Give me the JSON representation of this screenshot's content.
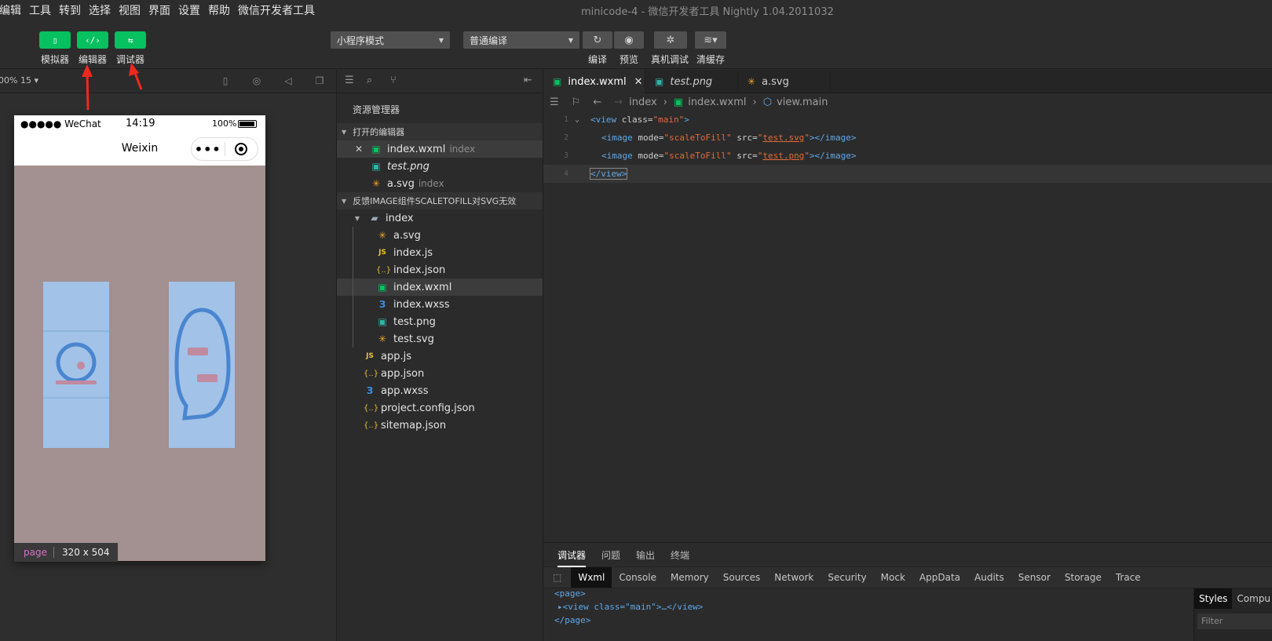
{
  "menubar": {
    "items": [
      "编辑",
      "工具",
      "转到",
      "选择",
      "视图",
      "界面",
      "设置",
      "帮助",
      "微信开发者工具"
    ],
    "window_title": "minicode-4 - 微信开发者工具 Nightly 1.04.2011032"
  },
  "toolbar": {
    "simulator_label": "模拟器",
    "editor_label": "编辑器",
    "debugger_label": "调试器",
    "mode_select": "小程序模式",
    "compile_select": "普通编译",
    "compile_label": "编译",
    "preview_label": "预览",
    "device_debug_label": "真机调试",
    "clear_cache_label": "清缓存",
    "accent_color": "#07c160"
  },
  "simulator": {
    "zoom": "00% 15",
    "carrier": "●●●●● WeChat",
    "time": "14:19",
    "battery": "100%",
    "nav_title": "Weixin",
    "page_tag": "page",
    "page_size": "320 x 504",
    "background_color": "#a39090",
    "image_fill_color": "#a2c2e8"
  },
  "explorer": {
    "header": "资源管理器",
    "open_editors_section": "打开的编辑器",
    "open_editors": [
      {
        "name": "index.wxml",
        "hint": "index",
        "icon": "wxml-icon"
      },
      {
        "name": "test.png",
        "hint": "",
        "icon": "png-icon"
      },
      {
        "name": "a.svg",
        "hint": "index",
        "icon": "svg-icon"
      }
    ],
    "project_section": "反馈IMAGE组件SCALETOFILL对SVG无效",
    "folder": "index",
    "folder_files": [
      "a.svg",
      "index.js",
      "index.json",
      "index.wxml",
      "index.wxss",
      "test.png",
      "test.svg"
    ],
    "root_files": [
      "app.js",
      "app.json",
      "app.wxss",
      "project.config.json",
      "sitemap.json"
    ]
  },
  "editor": {
    "tabs": [
      {
        "label": "index.wxml",
        "close": "✕"
      },
      {
        "label": "test.png",
        "close": ""
      },
      {
        "label": "a.svg",
        "close": ""
      }
    ],
    "breadcrumb": {
      "folder": "index",
      "file": "index.wxml",
      "symbol": "view.main"
    },
    "lines": {
      "l1": {
        "num": "1",
        "open": "<view ",
        "attr": "class=",
        "val": "\"main\"",
        "close": ">"
      },
      "l2": {
        "num": "2",
        "open": "<image ",
        "attr1": "mode=",
        "val1": "\"scaleToFill\"",
        "attr2": " src=",
        "q1": "\"",
        "link": "test.svg",
        "q2": "\"",
        "close": "></image>"
      },
      "l3": {
        "num": "3",
        "open": "<image ",
        "attr1": "mode=",
        "val1": "\"scaleToFill\"",
        "attr2": " src=",
        "q1": "\"",
        "link": "test.png",
        "q2": "\"",
        "close": "></image>"
      },
      "l4": {
        "num": "4",
        "text": "</view>"
      }
    }
  },
  "devtools": {
    "tabs": [
      "调试器",
      "问题",
      "输出",
      "终端"
    ],
    "panels": [
      "Wxml",
      "Console",
      "Memory",
      "Sources",
      "Network",
      "Security",
      "Mock",
      "AppData",
      "Audits",
      "Sensor",
      "Storage",
      "Trace"
    ],
    "dom": {
      "l1": "<page>",
      "l2": "▸<view class=\"main\">…</view>",
      "l3": "</page>"
    },
    "styles_tab": "Styles",
    "computed_tab": "Compu",
    "filter_placeholder": "Filter"
  }
}
